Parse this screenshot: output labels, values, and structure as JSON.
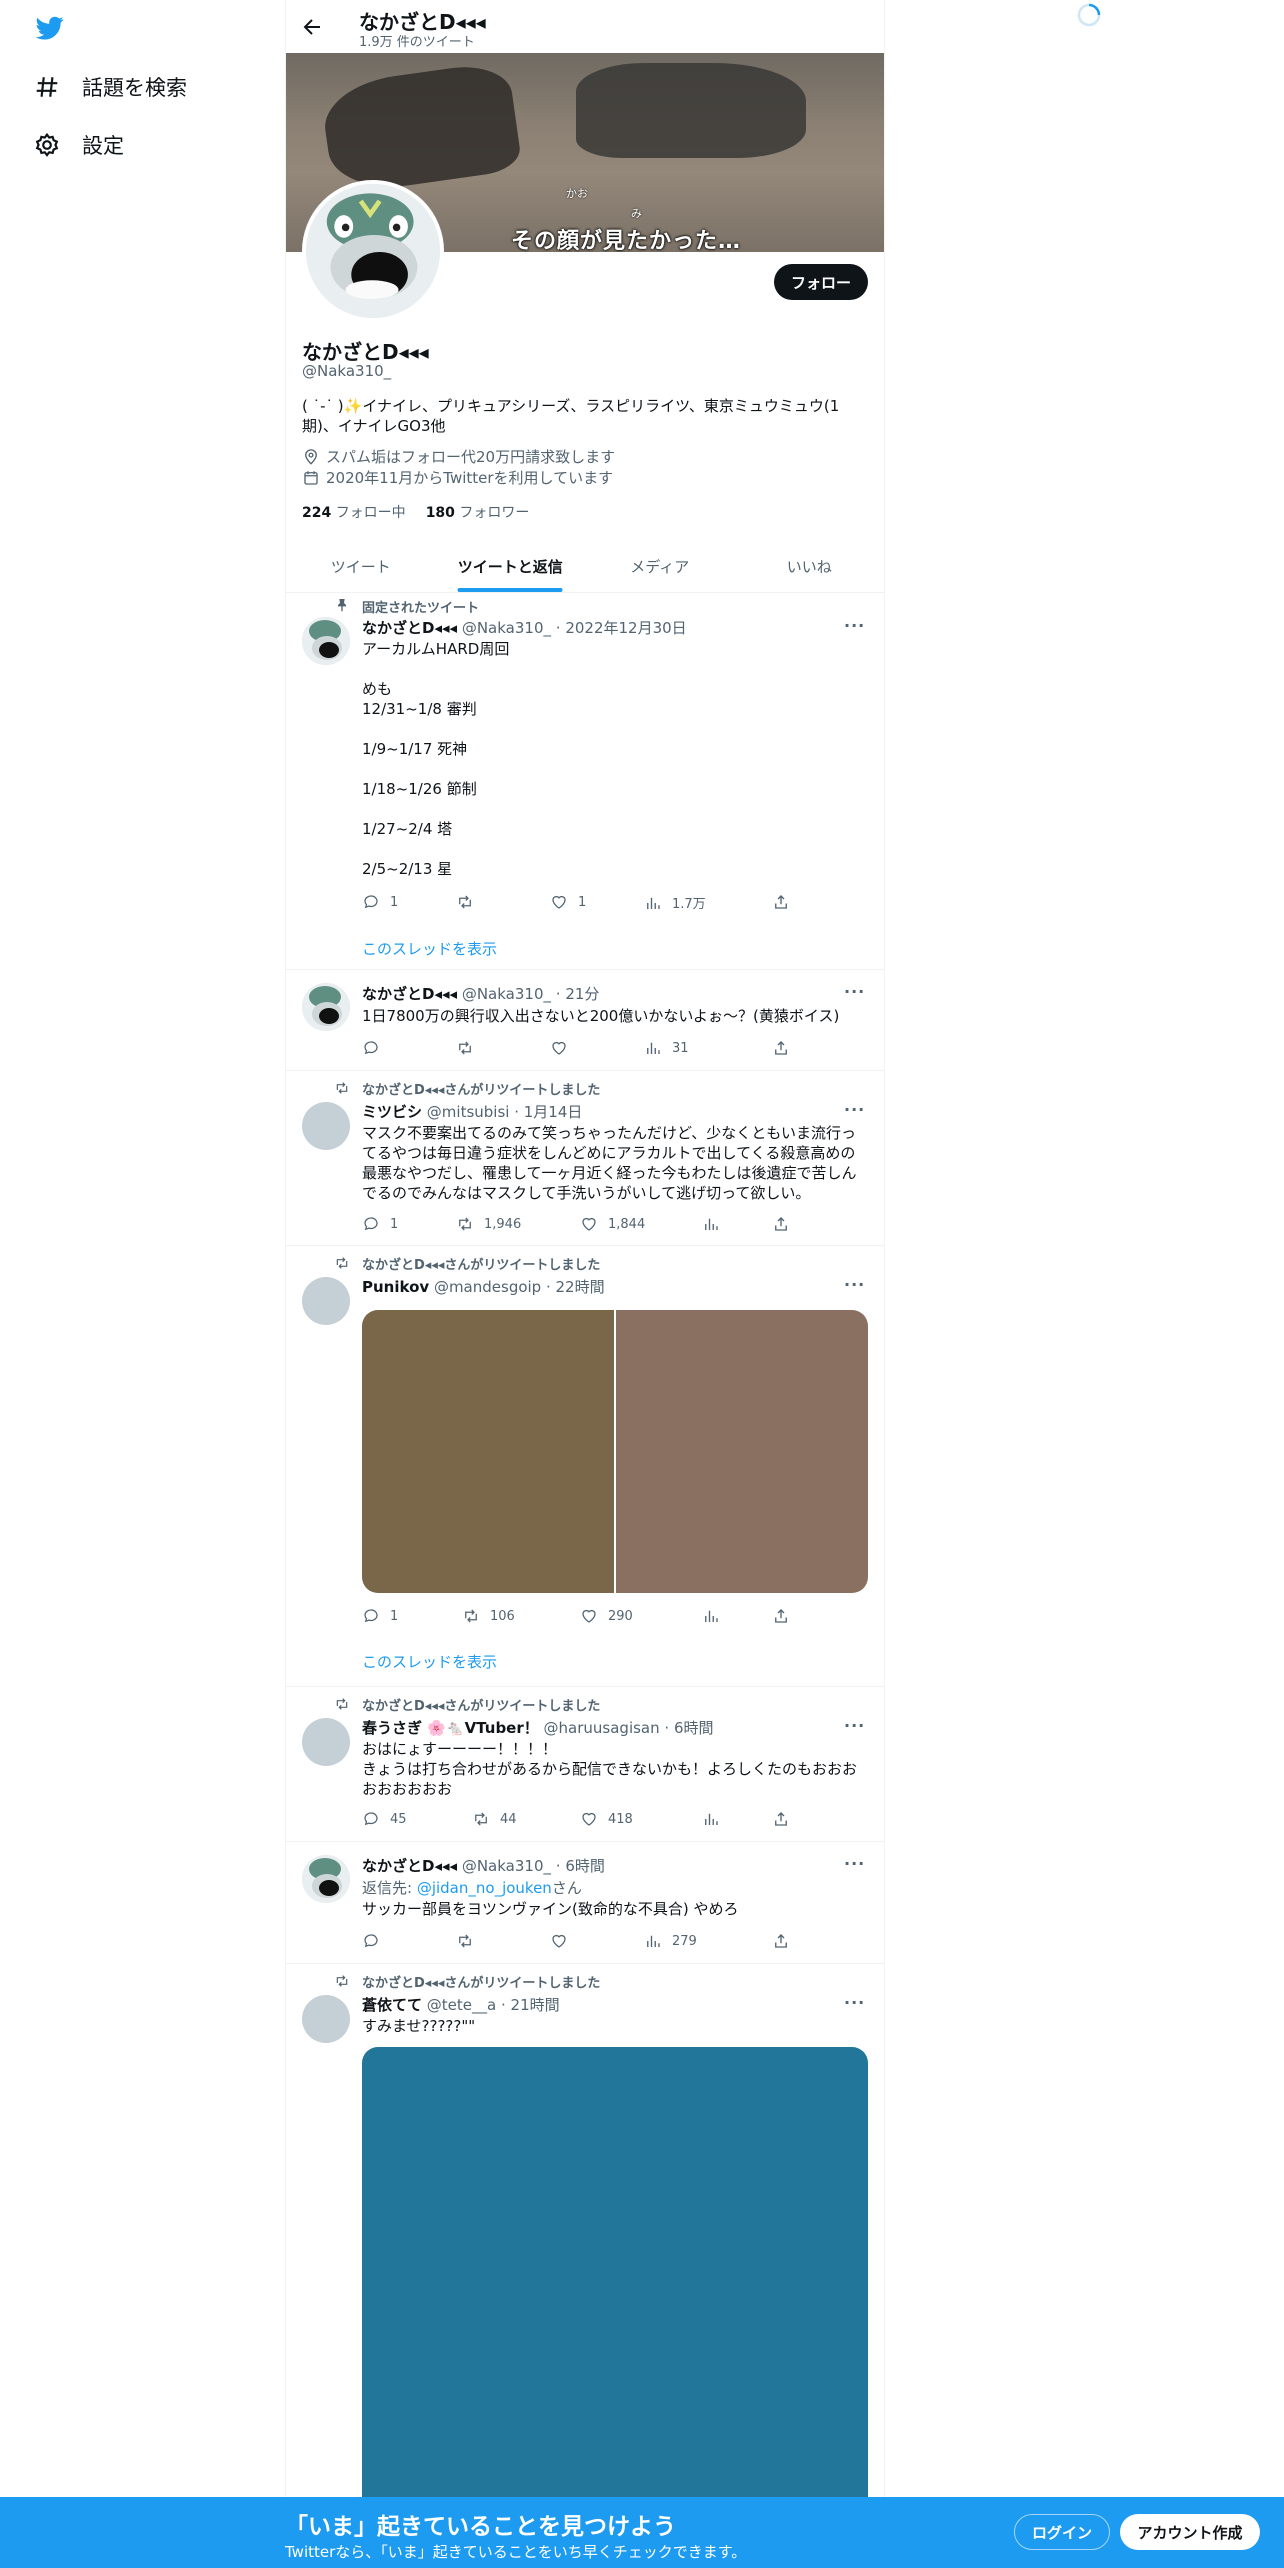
{
  "nav": {
    "items": [
      {
        "label": "話題を検索",
        "icon": "hashtag-icon"
      },
      {
        "label": "設定",
        "icon": "gear-icon"
      }
    ]
  },
  "header": {
    "name": "なかざとD◂◂◂",
    "tweet_count": "1.9万 件のツイート"
  },
  "banner": {
    "caption": "その顔が見たかった…",
    "small1": "かお",
    "small2": "み"
  },
  "profile": {
    "name": "なかざとD◂◂◂",
    "handle": "@Naka310_",
    "bio": "( ˙-˙ )✨イナイレ、プリキュアシリーズ、ラスピリライツ、東京ミュウミュウ(1期)、イナイレGO3他",
    "location": "スパム垢はフォロー代20万円請求致します",
    "joined": "2020年11月からTwitterを利用しています",
    "following_count": "224",
    "following_label": "フォロー中",
    "followers_count": "180",
    "followers_label": "フォロワー",
    "follow_button": "フォロー"
  },
  "tabs": [
    {
      "label": "ツイート",
      "active": false
    },
    {
      "label": "ツイートと返信",
      "active": true
    },
    {
      "label": "メディア",
      "active": false
    },
    {
      "label": "いいね",
      "active": false
    }
  ],
  "tweets": [
    {
      "context": "固定されたツイート",
      "name": "なかざとD◂◂◂",
      "handle": "@Naka310_",
      "time": "2022年12月30日",
      "text": "アーカルムHARD周回\n\nめも\n12/31~1/8 審判\n\n1/9~1/17 死神\n\n1/18~1/26 節制\n\n1/27~2/4 塔\n\n2/5~2/13 星",
      "replies": "1",
      "retweets": "",
      "likes": "1",
      "views": "1.7万",
      "thread_link": "このスレッドを表示"
    },
    {
      "name": "なかざとD◂◂◂",
      "handle": "@Naka310_",
      "time": "21分",
      "text": "1日7800万の興行収入出さないと200億いかないよぉ～？(黄猿ボイス)",
      "replies": "",
      "retweets": "",
      "likes": "",
      "views": "31"
    },
    {
      "context": "なかざとD◂◂◂さんがリツイートしました",
      "name": "ミツビシ",
      "handle": "@mitsubisi",
      "time": "1月14日",
      "text": "マスク不要案出てるのみて笑っちゃったんだけど、少なくともいま流行ってるやつは毎日違う症状をしんどめにアラカルトで出してくる殺意高めの最悪なやつだし、罹患して一ヶ月近く経った今もわたしは後遺症で苦しんでるのでみんなはマスクして手洗いうがいして逃げ切って欲しい。",
      "replies": "1",
      "retweets": "1,946",
      "likes": "1,844",
      "views": ""
    },
    {
      "context": "なかざとD◂◂◂さんがリツイートしました",
      "name": "Punikov",
      "handle": "@mandesgoip",
      "time": "22時間",
      "media_colors": [
        "#7a6648",
        "#8a7060"
      ],
      "replies": "1",
      "retweets": "106",
      "likes": "290",
      "views": "",
      "thread_link": "このスレッドを表示"
    },
    {
      "context": "なかざとD◂◂◂さんがリツイートしました",
      "name": "春うさぎ 🌸🐁VTuber！",
      "handle": "@haruusagisan",
      "time": "6時間",
      "text": "おはにょすーーーー！！！！\nきょうは打ち合わせがあるから配信できないかも！よろしくたのもおおおおおおおおお",
      "replies": "45",
      "retweets": "44",
      "likes": "418",
      "views": ""
    },
    {
      "name": "なかざとD◂◂◂",
      "handle": "@Naka310_",
      "time": "6時間",
      "reply_prefix": "返信先: ",
      "reply_to": "@jidan_no_jouken",
      "reply_suffix": "さん",
      "text": "サッカー部員をヨツンヴァイン(致命的な不具合) やめろ",
      "replies": "",
      "retweets": "",
      "likes": "",
      "views": "279"
    },
    {
      "context": "なかざとD◂◂◂さんがリツイートしました",
      "name": "蒼依てて",
      "handle": "@tete__a",
      "time": "21時間",
      "text": "すみませ?????\"\"",
      "media_colors": [
        "#21769a"
      ]
    }
  ],
  "bottom_bar": {
    "title": "「いま」起きていることを見つけよう",
    "subtitle": "Twitterなら、「いま」起きていることをいち早くチェックできます。",
    "login": "ログイン",
    "signup": "アカウント作成"
  },
  "colors": {
    "accent": "#1d9bf0",
    "text": "#0f1419",
    "muted": "#536471"
  }
}
